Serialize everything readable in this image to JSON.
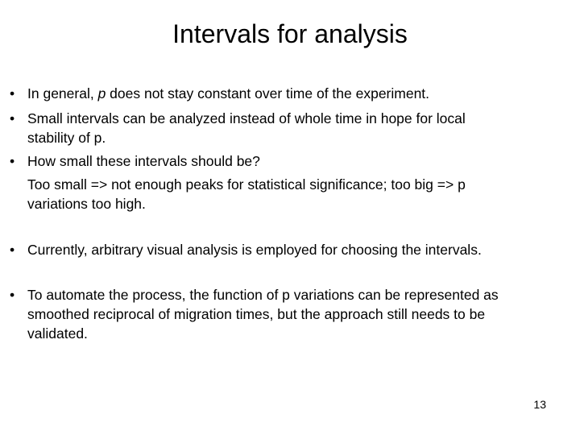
{
  "slide": {
    "title": "Intervals for analysis",
    "bullets": [
      {
        "parts": [
          "In general, ",
          "p",
          " does not stay constant over time of the experiment."
        ]
      },
      {
        "lines": [
          "Small intervals can be analyzed instead of whole time in hope for local",
          "stability of p."
        ]
      },
      {
        "lines": [
          "How small these intervals should be?",
          "Too small => not enough peaks for statistical significance; too big => p",
          "variations too high."
        ]
      },
      {
        "lines": [
          "Currently, arbitrary visual analysis is employed for choosing the intervals."
        ]
      },
      {
        "lines": [
          "To automate the process, the function of p variations can be represented as",
          "smoothed reciprocal of migration times, but the approach still needs to be",
          "validated."
        ]
      }
    ],
    "bullet_glyph": "•",
    "page_number": "13"
  }
}
